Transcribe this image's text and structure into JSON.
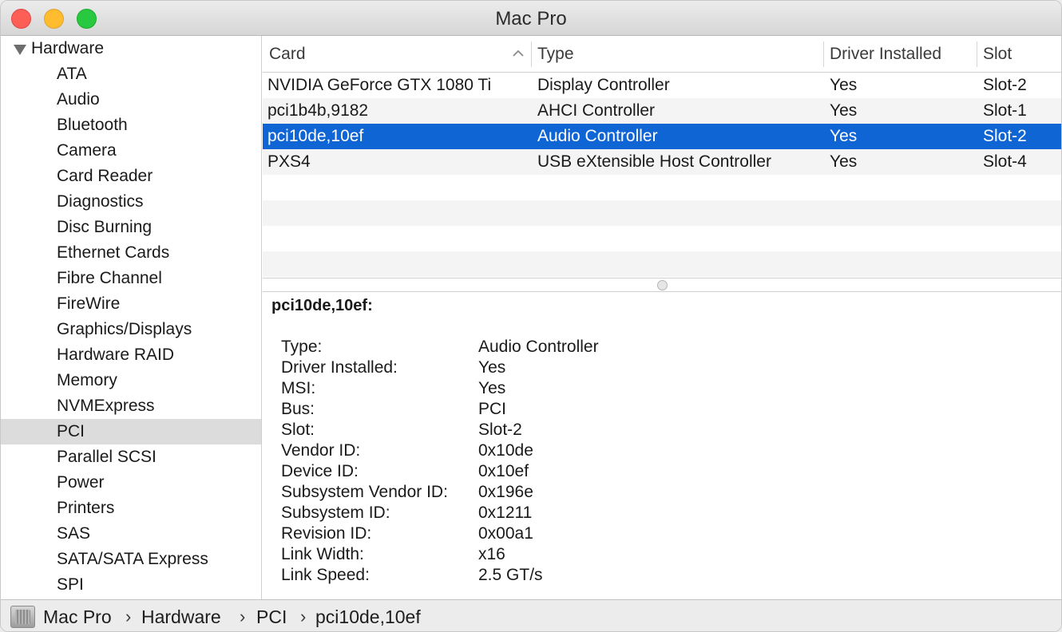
{
  "window": {
    "title": "Mac Pro"
  },
  "sidebar": {
    "group_label": "Hardware",
    "items": [
      "ATA",
      "Audio",
      "Bluetooth",
      "Camera",
      "Card Reader",
      "Diagnostics",
      "Disc Burning",
      "Ethernet Cards",
      "Fibre Channel",
      "FireWire",
      "Graphics/Displays",
      "Hardware RAID",
      "Memory",
      "NVMExpress",
      "PCI",
      "Parallel SCSI",
      "Power",
      "Printers",
      "SAS",
      "SATA/SATA Express",
      "SPI"
    ],
    "selected": "PCI"
  },
  "table": {
    "columns": [
      "Card",
      "Type",
      "Driver Installed",
      "Slot"
    ],
    "sort_column": "Card",
    "sort_direction": "ascending",
    "rows": [
      {
        "card": "NVIDIA GeForce GTX 1080 Ti",
        "type": "Display Controller",
        "driver": "Yes",
        "slot": "Slot-2"
      },
      {
        "card": "pci1b4b,9182",
        "type": "AHCI Controller",
        "driver": "Yes",
        "slot": "Slot-1"
      },
      {
        "card": "pci10de,10ef",
        "type": "Audio Controller",
        "driver": "Yes",
        "slot": "Slot-2"
      },
      {
        "card": "PXS4",
        "type": "USB eXtensible Host Controller",
        "driver": "Yes",
        "slot": "Slot-4"
      }
    ],
    "selected_row": 2
  },
  "details": {
    "title": "pci10de,10ef:",
    "fields": [
      {
        "label": "Type:",
        "value": "Audio Controller"
      },
      {
        "label": "Driver Installed:",
        "value": "Yes"
      },
      {
        "label": "MSI:",
        "value": "Yes"
      },
      {
        "label": "Bus:",
        "value": "PCI"
      },
      {
        "label": "Slot:",
        "value": "Slot-2"
      },
      {
        "label": "Vendor ID:",
        "value": "0x10de"
      },
      {
        "label": "Device ID:",
        "value": "0x10ef"
      },
      {
        "label": "Subsystem Vendor ID:",
        "value": "0x196e"
      },
      {
        "label": "Subsystem ID:",
        "value": "0x1211"
      },
      {
        "label": "Revision ID:",
        "value": "0x00a1"
      },
      {
        "label": "Link Width:",
        "value": "x16"
      },
      {
        "label": "Link Speed:",
        "value": "2.5 GT/s"
      }
    ]
  },
  "pathbar": {
    "crumbs": [
      "Mac Pro",
      "Hardware",
      "PCI",
      "pci10de,10ef"
    ],
    "separator": "›",
    "icon": "mac-pro-icon"
  },
  "colors": {
    "selection": "#1065d5",
    "sidebar_selected": "#dcdcdc",
    "alt_row": "#f4f4f4"
  }
}
